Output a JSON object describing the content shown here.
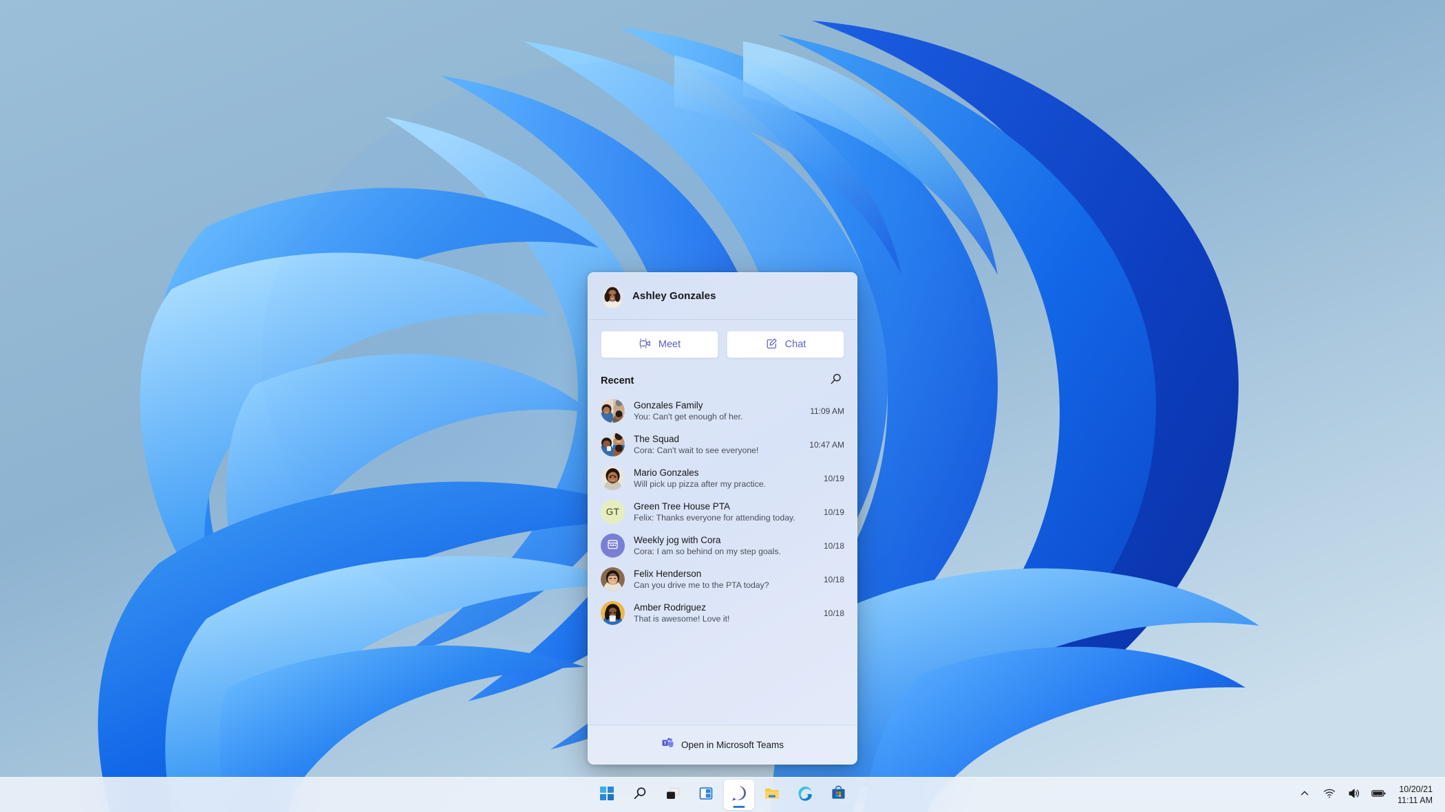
{
  "desktop": {
    "wallpaper_name": "windows-11-bloom-wallpaper",
    "background_color": "#8bb2d0"
  },
  "chat_flyout": {
    "header": {
      "user_name": "Ashley Gonzales",
      "avatar_name": "ashley-gonzales-avatar"
    },
    "actions": [
      {
        "label": "Meet",
        "icon": "video-camera-icon",
        "name": "meet-button"
      },
      {
        "label": "Chat",
        "icon": "compose-chat-icon",
        "name": "chat-button"
      }
    ],
    "recent": {
      "title": "Recent",
      "search_icon": "search-icon"
    },
    "conversations": [
      {
        "title": "Gonzales Family",
        "preview": "You: Can't get enough of her.",
        "time": "11:09 AM",
        "avatar_type": "group-photo",
        "avatar_name": "gonzales-family-group-avatar"
      },
      {
        "title": "The Squad",
        "preview": "Cora: Can't wait to see everyone!",
        "time": "10:47 AM",
        "avatar_type": "group-photo",
        "avatar_name": "the-squad-group-avatar"
      },
      {
        "title": "Mario Gonzales",
        "preview": "Will pick up pizza after my practice.",
        "time": "10/19",
        "avatar_type": "photo",
        "avatar_name": "mario-gonzales-avatar"
      },
      {
        "title": "Green Tree House PTA",
        "preview": "Felix: Thanks everyone for attending today.",
        "time": "10/19",
        "avatar_type": "initials",
        "avatar_initials": "GT",
        "avatar_bg": "#e6eec0",
        "avatar_name": "green-tree-house-pta-avatar"
      },
      {
        "title": "Weekly jog with Cora",
        "preview": "Cora: I am so behind on my step goals.",
        "time": "10/18",
        "avatar_type": "calendar-icon",
        "avatar_bg": "#7a7fd4",
        "avatar_name": "weekly-jog-with-cora-avatar"
      },
      {
        "title": "Felix Henderson",
        "preview": "Can you drive me to the PTA today?",
        "time": "10/18",
        "avatar_type": "photo",
        "avatar_name": "felix-henderson-avatar"
      },
      {
        "title": "Amber Rodriguez",
        "preview": "That is awesome! Love it!",
        "time": "10/18",
        "avatar_type": "photo",
        "avatar_name": "amber-rodriguez-avatar"
      }
    ],
    "footer": {
      "label": "Open in Microsoft Teams",
      "icon": "microsoft-teams-icon"
    },
    "accent_color": "#5b5fc7"
  },
  "taskbar": {
    "buttons": [
      {
        "name": "start-button",
        "icon": "windows-logo-icon",
        "active": false
      },
      {
        "name": "search-button",
        "icon": "search-icon",
        "active": false
      },
      {
        "name": "task-view-button",
        "icon": "task-view-icon",
        "active": false
      },
      {
        "name": "widgets-button",
        "icon": "widgets-icon",
        "active": false
      },
      {
        "name": "teams-chat-button",
        "icon": "teams-chat-icon",
        "active": true
      },
      {
        "name": "file-explorer-button",
        "icon": "folder-icon",
        "active": false
      },
      {
        "name": "edge-button",
        "icon": "edge-icon",
        "active": false
      },
      {
        "name": "microsoft-store-button",
        "icon": "store-icon",
        "active": false
      }
    ],
    "tray": {
      "overflow_icon": "chevron-up-icon",
      "network_icon": "wifi-icon",
      "volume_icon": "speaker-icon",
      "battery_icon": "battery-icon",
      "date": "10/20/21",
      "time": "11:11 AM"
    }
  }
}
